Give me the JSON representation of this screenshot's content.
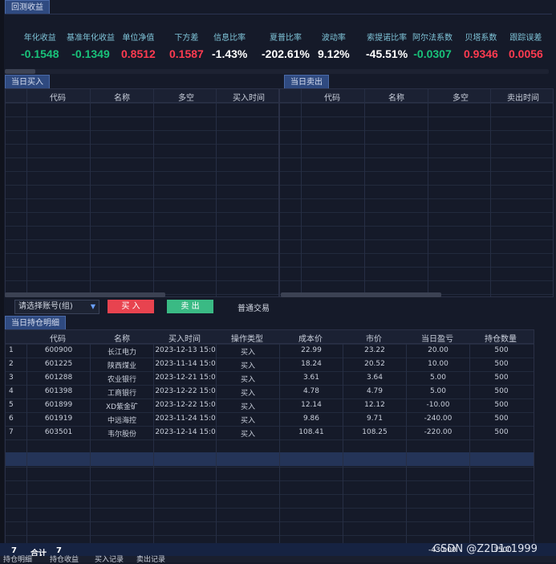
{
  "tabs": {
    "returns": "回测收益",
    "buy_today": "当日买入",
    "sell_today": "当日卖出",
    "holdings": "当日持仓明细"
  },
  "stats": [
    {
      "label": "年化收益",
      "value": "-0.1548",
      "color": "#19c27a"
    },
    {
      "label": "基准年化收益",
      "value": "-0.1349",
      "color": "#19c27a"
    },
    {
      "label": "单位净值",
      "value": "0.8512",
      "color": "#ff3b50"
    },
    {
      "label": "下方差",
      "value": "0.1587",
      "color": "#ff3b50"
    },
    {
      "label": "信息比率",
      "value": "-1.43%",
      "color": "#ffffff"
    },
    {
      "label": "夏普比率",
      "value": "-202.61%",
      "color": "#ffffff"
    },
    {
      "label": "波动率",
      "value": "9.12%",
      "color": "#ffffff"
    },
    {
      "label": "索提诺比率",
      "value": "-45.51%",
      "color": "#ffffff"
    },
    {
      "label": "阿尔法系数",
      "value": "-0.0307",
      "color": "#19c27a"
    },
    {
      "label": "贝塔系数",
      "value": "0.9346",
      "color": "#ff3b50"
    },
    {
      "label": "跟踪误差",
      "value": "0.0056",
      "color": "#ff3b50"
    }
  ],
  "buy_columns": [
    "代码",
    "名称",
    "多空",
    "买入时间"
  ],
  "sell_columns": [
    "代码",
    "名称",
    "多空",
    "卖出时间"
  ],
  "toolbar": {
    "account_placeholder": "请选择账号(组)",
    "buy_label": "买 入",
    "sell_label": "卖 出",
    "mode_label": "普通交易"
  },
  "holdings_columns": [
    "代码",
    "名称",
    "买入时间",
    "操作类型",
    "成本价",
    "市价",
    "当日盈亏",
    "持仓数量"
  ],
  "holdings": [
    {
      "idx": "1",
      "code": "600900",
      "name": "长江电力",
      "time": "2023-12-13 15:0",
      "op": "买入",
      "cost": "22.99",
      "price": "23.22",
      "pnl": "20.00",
      "qty": "500"
    },
    {
      "idx": "2",
      "code": "601225",
      "name": "陕西煤业",
      "time": "2023-11-14 15:0",
      "op": "买入",
      "cost": "18.24",
      "price": "20.52",
      "pnl": "10.00",
      "qty": "500"
    },
    {
      "idx": "3",
      "code": "601288",
      "name": "农业银行",
      "time": "2023-12-21 15:0",
      "op": "买入",
      "cost": "3.61",
      "price": "3.64",
      "pnl": "5.00",
      "qty": "500"
    },
    {
      "idx": "4",
      "code": "601398",
      "name": "工商银行",
      "time": "2023-12-22 15:0",
      "op": "买入",
      "cost": "4.78",
      "price": "4.79",
      "pnl": "5.00",
      "qty": "500"
    },
    {
      "idx": "5",
      "code": "601899",
      "name": "XD紫金矿",
      "time": "2023-12-22 15:0",
      "op": "买入",
      "cost": "12.14",
      "price": "12.12",
      "pnl": "-10.00",
      "qty": "500"
    },
    {
      "idx": "6",
      "code": "601919",
      "name": "中远海控",
      "time": "2023-11-24 15:0",
      "op": "买入",
      "cost": "9.86",
      "price": "9.71",
      "pnl": "-240.00",
      "qty": "500"
    },
    {
      "idx": "7",
      "code": "603501",
      "name": "韦尔股份",
      "time": "2023-12-14 15:0",
      "op": "买入",
      "cost": "108.41",
      "price": "108.25",
      "pnl": "-220.00",
      "qty": "500"
    }
  ],
  "footer": {
    "count": "7",
    "total_label": "合计",
    "total_count": "7",
    "pnl_total": "-430.00",
    "qty_total": "3500"
  },
  "bottom_tabs": [
    "持仓明细",
    "持仓收益",
    "买入记录",
    "卖出记录"
  ],
  "watermark": "CSDN @Z2D1c1999"
}
